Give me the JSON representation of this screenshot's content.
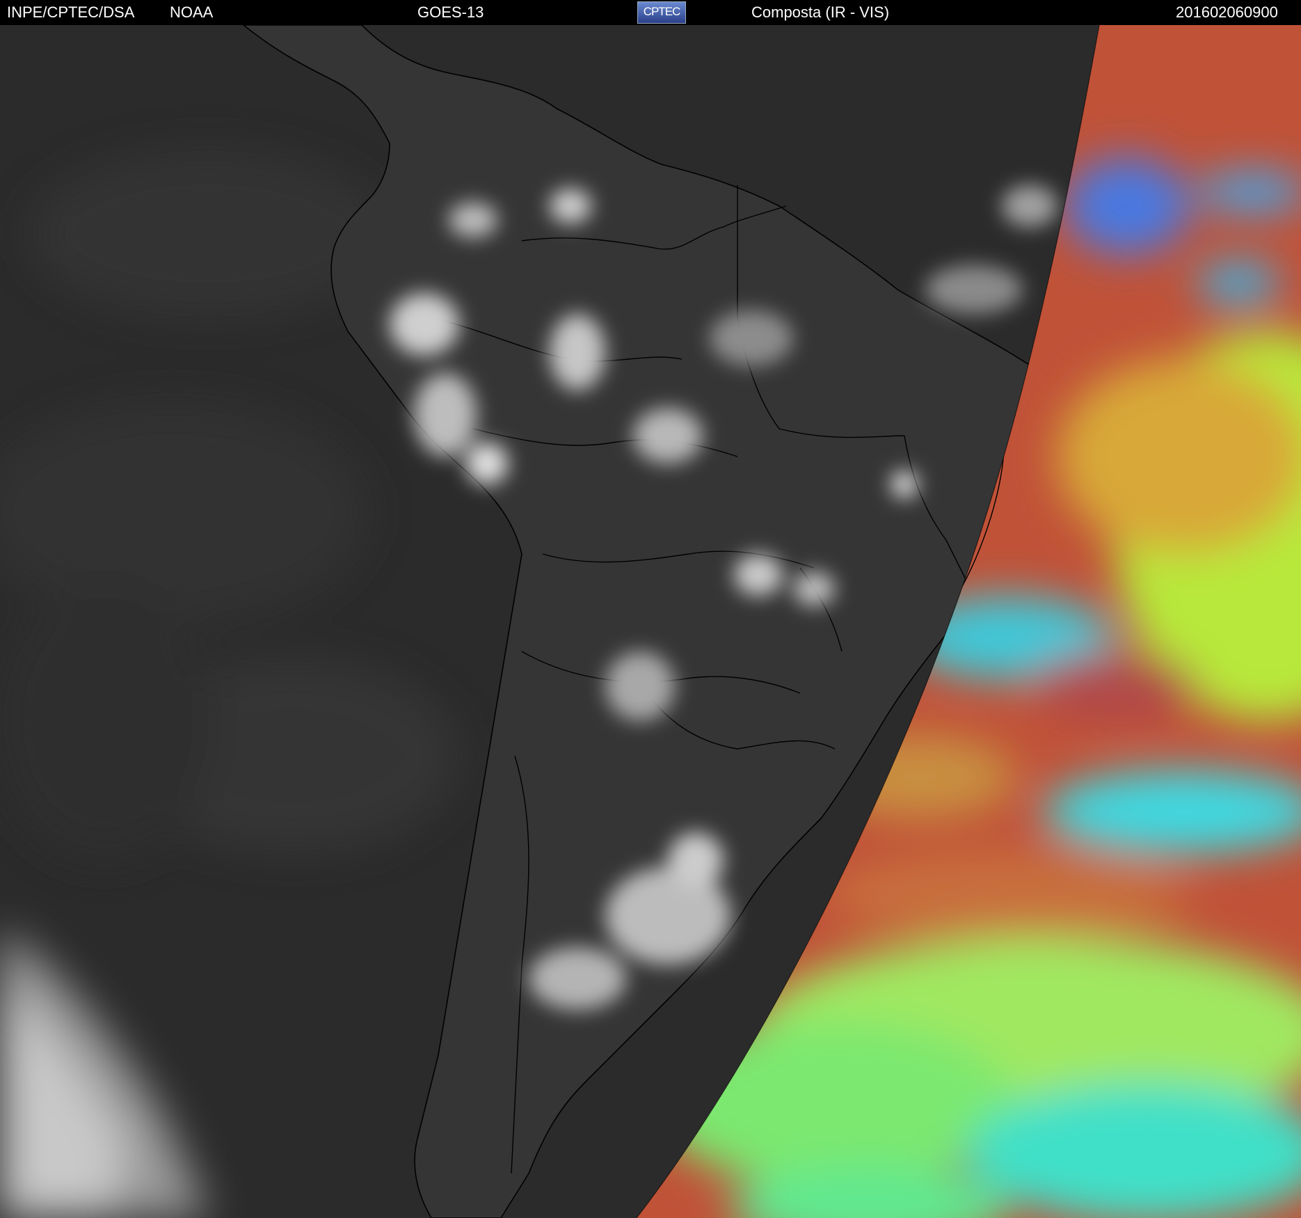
{
  "header": {
    "institution": "INPE/CPTEC/DSA",
    "agency": "NOAA",
    "satellite": "GOES-13",
    "logo_text": "CPTEC",
    "product": "Composta (IR - VIS)",
    "timestamp": "201602060900"
  },
  "map": {
    "region": "South America",
    "night_segment_style": "grayscale infrared",
    "day_segment_style": "false-color composite",
    "colors": {
      "background": "#000000",
      "header_text": "#ffffff",
      "ocean_ir": "#2c2c2c",
      "land_ir": "#363636",
      "cloud_ir": "#d8d8d8",
      "border_lines": "#000000",
      "day_red": "#c0503c",
      "day_green": "#a8f040",
      "day_cyan": "#40e0e0",
      "day_blue": "#4070e0"
    }
  }
}
